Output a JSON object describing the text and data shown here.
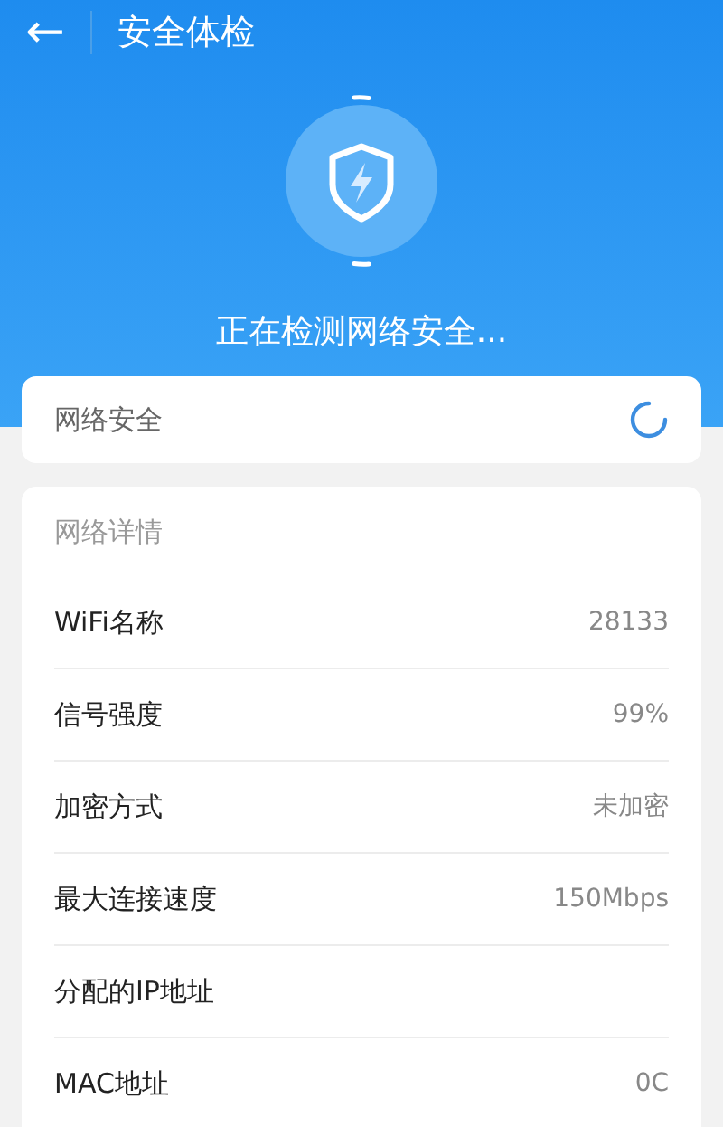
{
  "title_bar": {
    "back": "←",
    "title": "安全体检"
  },
  "scan": {
    "status": "正在检测网络安全..."
  },
  "check_card": {
    "label": "网络安全",
    "loading": true
  },
  "details": {
    "heading": "网络详情",
    "rows": [
      {
        "label": "WiFi名称",
        "value": "28133"
      },
      {
        "label": "信号强度",
        "value": "99%"
      },
      {
        "label": "加密方式",
        "value": "未加密"
      },
      {
        "label": "最大连接速度",
        "value": "150Mbps"
      },
      {
        "label": "分配的IP地址"
      },
      {
        "label": "MAC地址",
        "value": "0C"
      }
    ]
  }
}
